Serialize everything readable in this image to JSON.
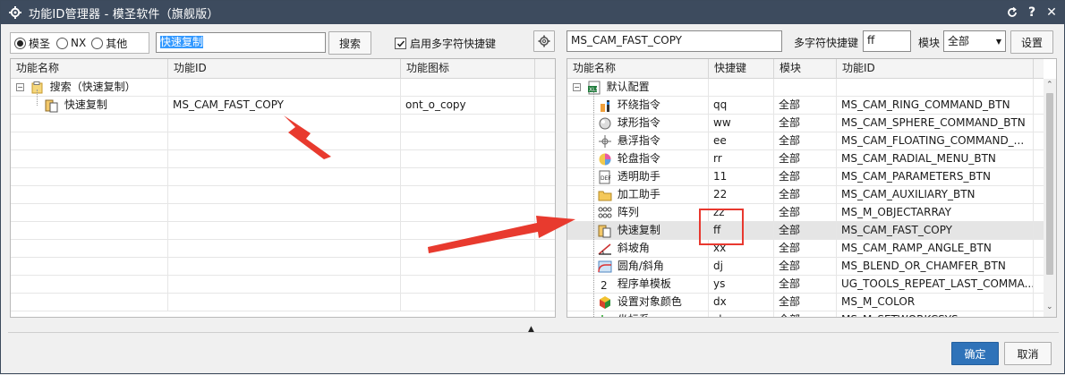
{
  "window": {
    "title": "功能ID管理器 - 模圣软件（旗舰版）"
  },
  "left": {
    "radio_options": [
      {
        "label": "模圣",
        "selected": true
      },
      {
        "label": "NX",
        "selected": false
      },
      {
        "label": "其他",
        "selected": false
      }
    ],
    "search_value": "快速复制",
    "search_button": "搜索",
    "checkbox_label": "启用多字符快捷键",
    "checkbox_checked": true,
    "columns": [
      "功能名称",
      "功能ID",
      "功能图标"
    ],
    "tree_root": "搜索（快速复制）",
    "rows": [
      {
        "name": "快速复制",
        "id": "MS_CAM_FAST_COPY",
        "icon": "ont_o_copy"
      }
    ]
  },
  "right": {
    "search_value": "MS_CAM_FAST_COPY",
    "hotkey_label": "多字符快捷键",
    "hotkey_value": "ff",
    "module_label": "模块",
    "module_value": "全部",
    "settings_button": "设置",
    "columns": [
      "功能名称",
      "快捷键",
      "模块",
      "功能ID"
    ],
    "tree_root": "默认配置",
    "rows": [
      {
        "name": "环绕指令",
        "key": "qq",
        "module": "全部",
        "id": "MS_CAM_RING_COMMAND_BTN",
        "icon": "ring-icon"
      },
      {
        "name": "球形指令",
        "key": "ww",
        "module": "全部",
        "id": "MS_CAM_SPHERE_COMMAND_BTN",
        "icon": "sphere-icon"
      },
      {
        "name": "悬浮指令",
        "key": "ee",
        "module": "全部",
        "id": "MS_CAM_FLOATING_COMMAND_...",
        "icon": "floating-icon"
      },
      {
        "name": "轮盘指令",
        "key": "rr",
        "module": "全部",
        "id": "MS_CAM_RADIAL_MENU_BTN",
        "icon": "radial-icon"
      },
      {
        "name": "透明助手",
        "key": "11",
        "module": "全部",
        "id": "MS_CAM_PARAMETERS_BTN",
        "icon": "transparent-icon"
      },
      {
        "name": "加工助手",
        "key": "22",
        "module": "全部",
        "id": "MS_CAM_AUXILIARY_BTN",
        "icon": "folder-icon"
      },
      {
        "name": "阵列",
        "key": "zz",
        "module": "全部",
        "id": "MS_M_OBJECTARRAY",
        "icon": "array-icon"
      },
      {
        "name": "快速复制",
        "key": "ff",
        "module": "全部",
        "id": "MS_CAM_FAST_COPY",
        "icon": "copy-icon"
      },
      {
        "name": "斜坡角",
        "key": "xx",
        "module": "全部",
        "id": "MS_CAM_RAMP_ANGLE_BTN",
        "icon": "ramp-icon"
      },
      {
        "name": "圆角/斜角",
        "key": "dj",
        "module": "全部",
        "id": "MS_BLEND_OR_CHAMFER_BTN",
        "icon": "blend-icon"
      },
      {
        "name": "程序单模板",
        "key": "ys",
        "module": "全部",
        "id": "UG_TOOLS_REPEAT_LAST_COMMA...",
        "icon": "number-two-icon"
      },
      {
        "name": "设置对象颜色",
        "key": "dx",
        "module": "全部",
        "id": "MS_M_COLOR",
        "icon": "color-icon"
      },
      {
        "name": "坐标系",
        "key": "zb",
        "module": "全部",
        "id": "MS_M_SETWORKCSYS",
        "icon": "csys-icon"
      }
    ]
  },
  "footer": {
    "ok": "确定",
    "cancel": "取消"
  }
}
